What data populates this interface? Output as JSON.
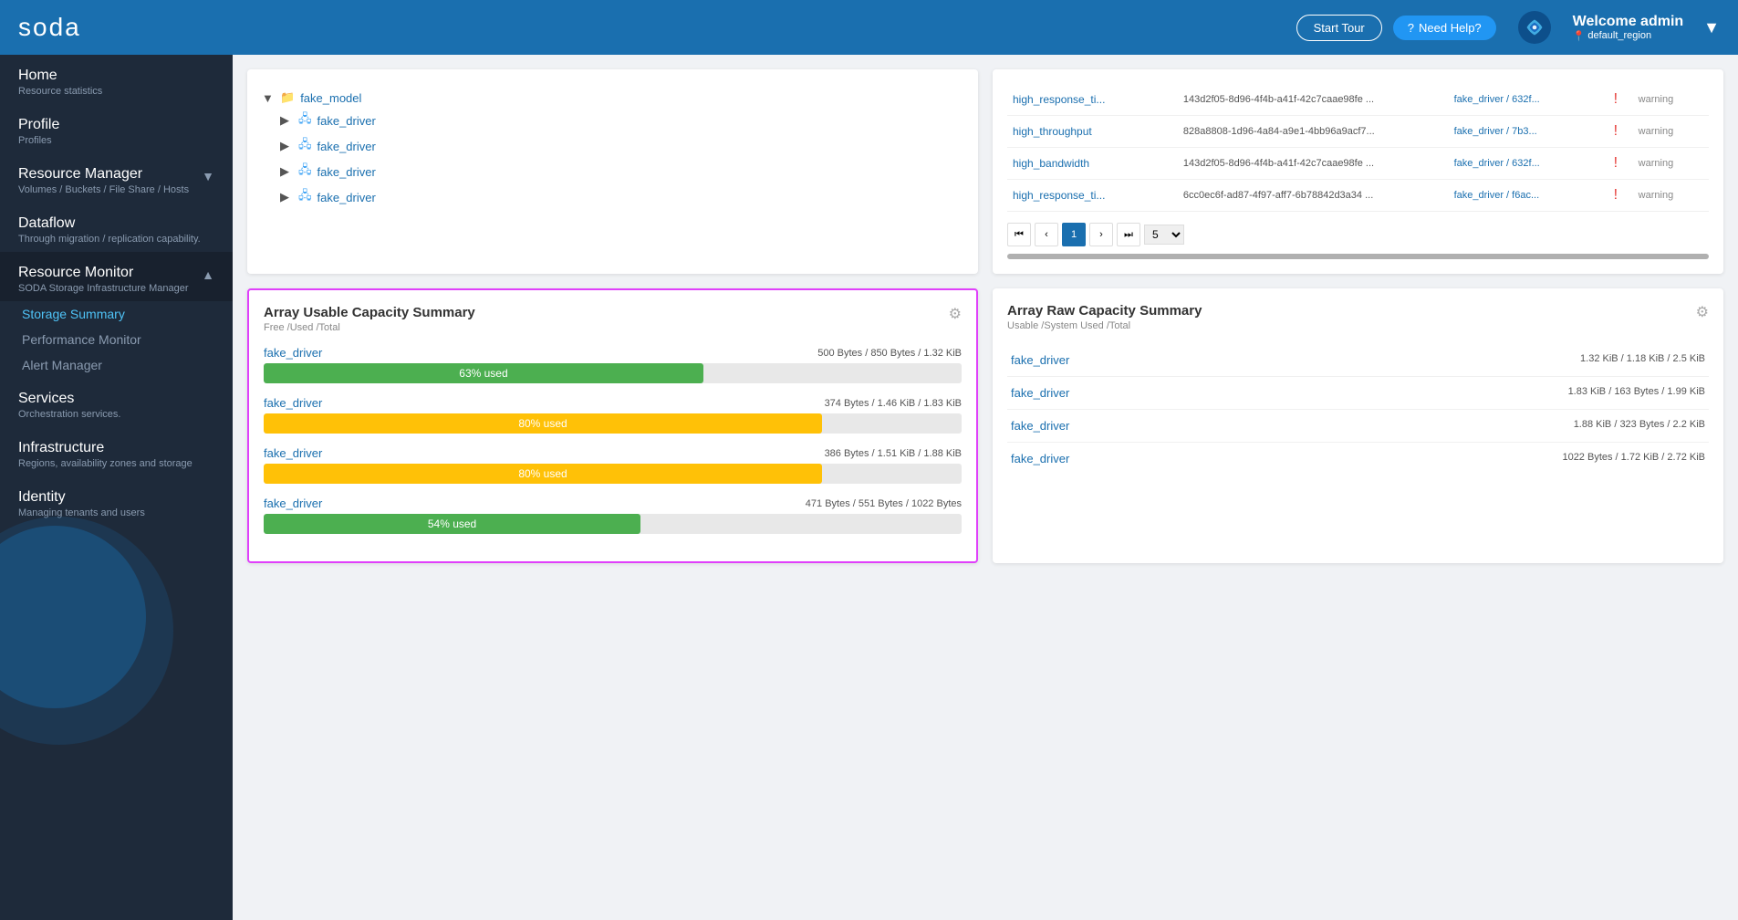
{
  "header": {
    "logo": "soda",
    "start_tour_label": "Start Tour",
    "need_help_label": "Need Help?",
    "welcome_label": "Welcome admin",
    "region": "default_region"
  },
  "sidebar": {
    "home_label": "Home",
    "home_sub": "Resource statistics",
    "profile_label": "Profile",
    "profile_sub": "Profiles",
    "resource_manager_label": "Resource Manager",
    "resource_manager_sub": "Volumes / Buckets / File Share / Hosts",
    "dataflow_label": "Dataflow",
    "dataflow_sub": "Through migration / replication capability.",
    "resource_monitor_label": "Resource Monitor",
    "resource_monitor_sub": "SODA Storage Infrastructure Manager",
    "storage_summary_label": "Storage Summary",
    "performance_monitor_label": "Performance Monitor",
    "alert_manager_label": "Alert Manager",
    "services_label": "Services",
    "services_sub": "Orchestration services.",
    "infrastructure_label": "Infrastructure",
    "infrastructure_sub": "Regions, availability zones and storage",
    "identity_label": "Identity",
    "identity_sub": "Managing tenants and users"
  },
  "tree_card": {
    "items": [
      {
        "level": 0,
        "label": "fake_model",
        "type": "folder"
      },
      {
        "level": 1,
        "label": "fake_driver",
        "type": "db"
      },
      {
        "level": 1,
        "label": "fake_driver",
        "type": "db"
      },
      {
        "level": 1,
        "label": "fake_driver",
        "type": "db"
      },
      {
        "level": 1,
        "label": "fake_driver",
        "type": "db"
      }
    ]
  },
  "alerts_table": {
    "rows": [
      {
        "name": "high_response_ti...",
        "id": "143d2f05-8d96-4f4b-a41f-42c7caae98fe ...",
        "driver": "fake_driver / 632f...",
        "severity": "warning"
      },
      {
        "name": "high_throughput",
        "id": "828a8808-1d96-4a84-a9e1-4bb96a9acf7...",
        "driver": "fake_driver / 7b3...",
        "severity": "warning"
      },
      {
        "name": "high_bandwidth",
        "id": "143d2f05-8d96-4f4b-a41f-42c7caae98fe ...",
        "driver": "fake_driver / 632f...",
        "severity": "warning"
      },
      {
        "name": "high_response_ti...",
        "id": "6cc0ec6f-ad87-4f97-aff7-6b78842d3a34 ...",
        "driver": "fake_driver / f6ac...",
        "severity": "warning"
      }
    ],
    "pagination": {
      "current_page": 1,
      "per_page": 5
    }
  },
  "usable_capacity": {
    "title": "Array Usable Capacity Summary",
    "subtitle": "Free /Used /Total",
    "rows": [
      {
        "label": "fake_driver",
        "values": "500 Bytes / 850 Bytes / 1.32 KiB",
        "percent": 63,
        "percent_label": "63% used",
        "color": "green"
      },
      {
        "label": "fake_driver",
        "values": "374 Bytes / 1.46 KiB / 1.83 KiB",
        "percent": 80,
        "percent_label": "80% used",
        "color": "yellow"
      },
      {
        "label": "fake_driver",
        "values": "386 Bytes / 1.51 KiB / 1.88 KiB",
        "percent": 80,
        "percent_label": "80% used",
        "color": "yellow"
      },
      {
        "label": "fake_driver",
        "values": "471 Bytes / 551 Bytes / 1022 Bytes",
        "percent": 54,
        "percent_label": "54% used",
        "color": "green"
      }
    ]
  },
  "raw_capacity": {
    "title": "Array Raw Capacity Summary",
    "subtitle": "Usable /System Used /Total",
    "rows": [
      {
        "label": "fake_driver",
        "values": "1.32 KiB / 1.18 KiB / 2.5 KiB"
      },
      {
        "label": "fake_driver",
        "values": "1.83 KiB / 163 Bytes / 1.99 KiB"
      },
      {
        "label": "fake_driver",
        "values": "1.88 KiB / 323 Bytes / 2.2 KiB"
      },
      {
        "label": "fake_driver",
        "values": "1022 Bytes / 1.72 KiB / 2.72 KiB"
      }
    ]
  },
  "colors": {
    "accent_blue": "#1a6faf",
    "highlight_border": "#e040fb",
    "sidebar_bg": "#1e2a3a",
    "header_bg": "#1a6faf"
  }
}
